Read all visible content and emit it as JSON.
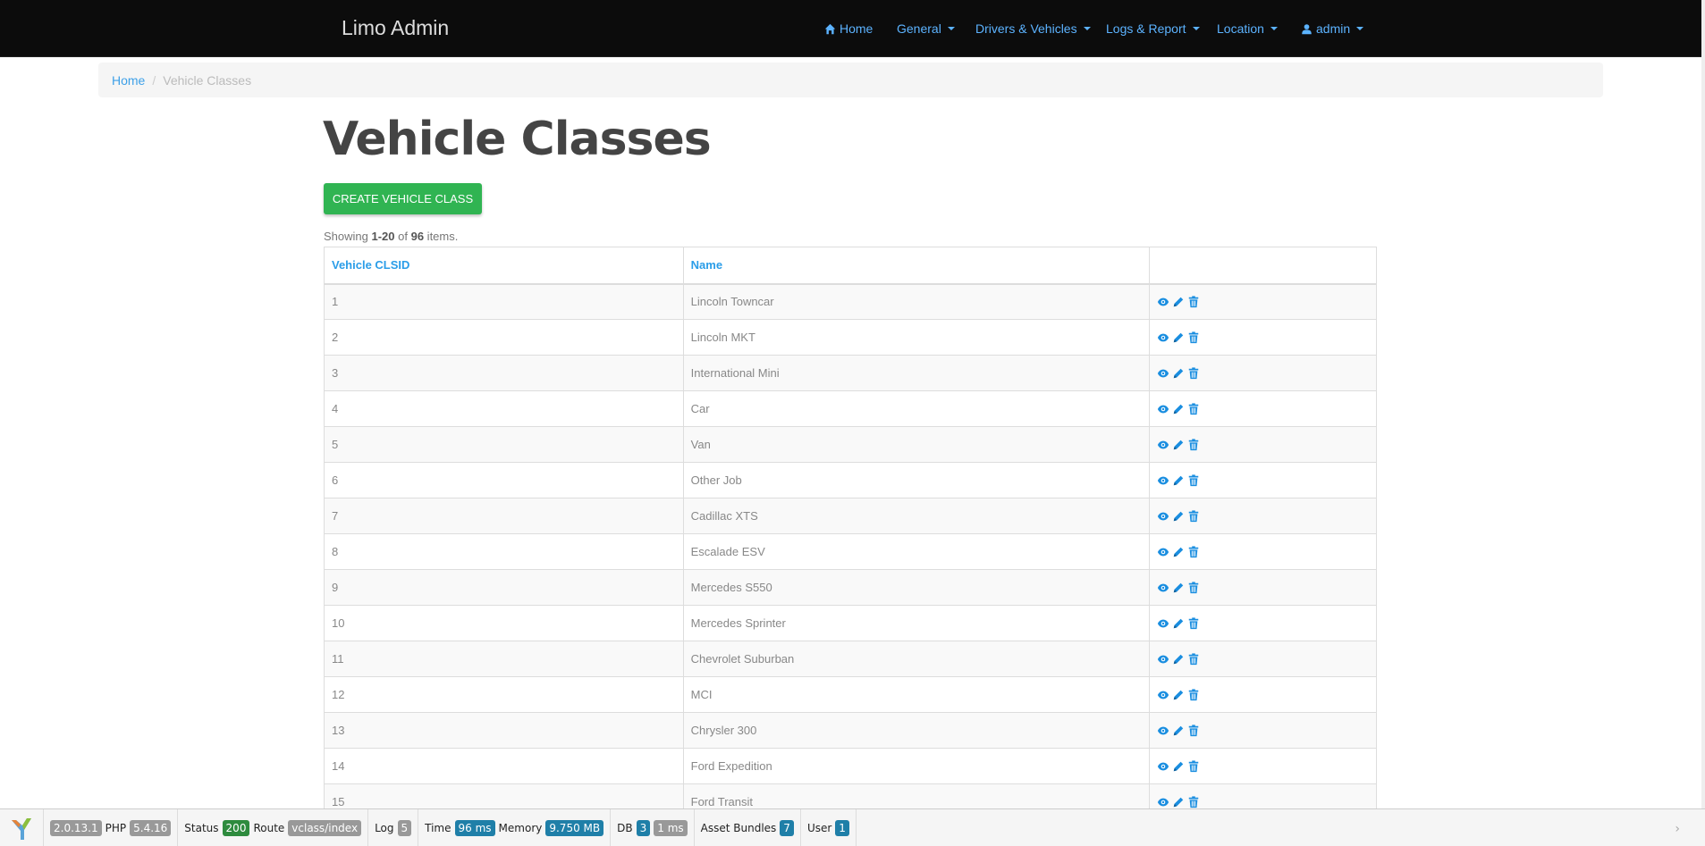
{
  "navbar": {
    "brand": "Limo Admin",
    "items": [
      {
        "label": "Home"
      },
      {
        "label": "General"
      },
      {
        "label": "Drivers & Vehicles"
      },
      {
        "label": "Logs & Report"
      },
      {
        "label": "Location"
      },
      {
        "label": "admin"
      }
    ]
  },
  "breadcrumb": {
    "home": "Home",
    "current": "Vehicle Classes"
  },
  "page": {
    "title": "Vehicle Classes",
    "create_label": "CREATE VEHICLE CLASS",
    "summary": {
      "prefix": "Showing ",
      "range": "1-20",
      "of": " of ",
      "total": "96",
      "suffix": " items."
    }
  },
  "table": {
    "headers": [
      "Vehicle CLSID",
      "Name",
      ""
    ],
    "rows": [
      {
        "id": "1",
        "name": "Lincoln Towncar"
      },
      {
        "id": "2",
        "name": "Lincoln MKT"
      },
      {
        "id": "3",
        "name": "International Mini"
      },
      {
        "id": "4",
        "name": "Car"
      },
      {
        "id": "5",
        "name": "Van"
      },
      {
        "id": "6",
        "name": "Other Job"
      },
      {
        "id": "7",
        "name": "Cadillac XTS"
      },
      {
        "id": "8",
        "name": "Escalade ESV"
      },
      {
        "id": "9",
        "name": "Mercedes S550"
      },
      {
        "id": "10",
        "name": "Mercedes Sprinter"
      },
      {
        "id": "11",
        "name": "Chevrolet Suburban"
      },
      {
        "id": "12",
        "name": "MCI"
      },
      {
        "id": "13",
        "name": "Chrysler 300"
      },
      {
        "id": "14",
        "name": "Ford Expedition"
      },
      {
        "id": "15",
        "name": "Ford Transit"
      }
    ],
    "action_icons": [
      "eye-icon",
      "pencil-icon",
      "trash-icon"
    ]
  },
  "debug_toolbar": {
    "yii_version": "2.0.13.1",
    "php_label": "PHP",
    "php_version": "5.4.16",
    "status_label": "Status",
    "status_code": "200",
    "route_label": "Route",
    "route": "vclass/index",
    "log_label": "Log",
    "log_count": "5",
    "time_label": "Time",
    "time": "96 ms",
    "memory_label": "Memory",
    "memory": "9.750 MB",
    "db_label": "DB",
    "db_count": "3",
    "db_time": "1 ms",
    "bundles_label": "Asset Bundles",
    "bundles_count": "7",
    "user_label": "User",
    "user_id": "1"
  },
  "colors": {
    "link": "#3da0e8",
    "create_button": "#30b452",
    "navbar": "#0c0c0c"
  }
}
